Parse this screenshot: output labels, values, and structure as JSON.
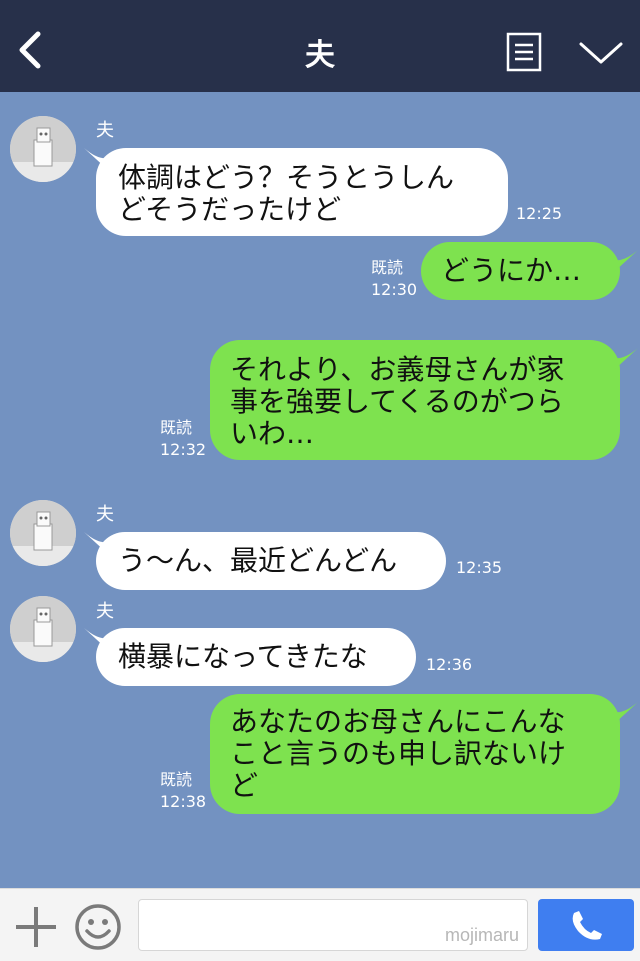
{
  "header": {
    "title": "夫"
  },
  "messages": [
    {
      "side": "left",
      "sender": "夫",
      "text": "体調はどう？そうとうしん\nどそうだったけど",
      "time": "12:25"
    },
    {
      "side": "right",
      "read": "既読",
      "text": "どうにか…",
      "time": "12:30"
    },
    {
      "side": "right",
      "read": "既読",
      "text": "それより、お義母さんが家\n事を強要してくるのがつら\nいわ…",
      "time": "12:32"
    },
    {
      "side": "left",
      "sender": "夫",
      "text": "う～ん、最近どんどん",
      "time": "12:35"
    },
    {
      "side": "left",
      "sender": "夫",
      "text": "横暴になってきたな",
      "time": "12:36"
    },
    {
      "side": "right",
      "read": "既読",
      "text": "あなたのお母さんにこんな\nこと言うのも申し訳ないけ\nど",
      "time": "12:38"
    }
  ],
  "footer": {
    "watermark": "mojimaru"
  },
  "colors": {
    "header_bg": "#27304a",
    "chat_bg": "#7392c1",
    "mine_bubble": "#7ee24f",
    "their_bubble": "#ffffff",
    "call_button": "#3f7ef0"
  },
  "icons": [
    "back-icon",
    "menu-icon",
    "chevron-down-icon",
    "avatar",
    "plus-icon",
    "smile-icon",
    "phone-icon"
  ]
}
